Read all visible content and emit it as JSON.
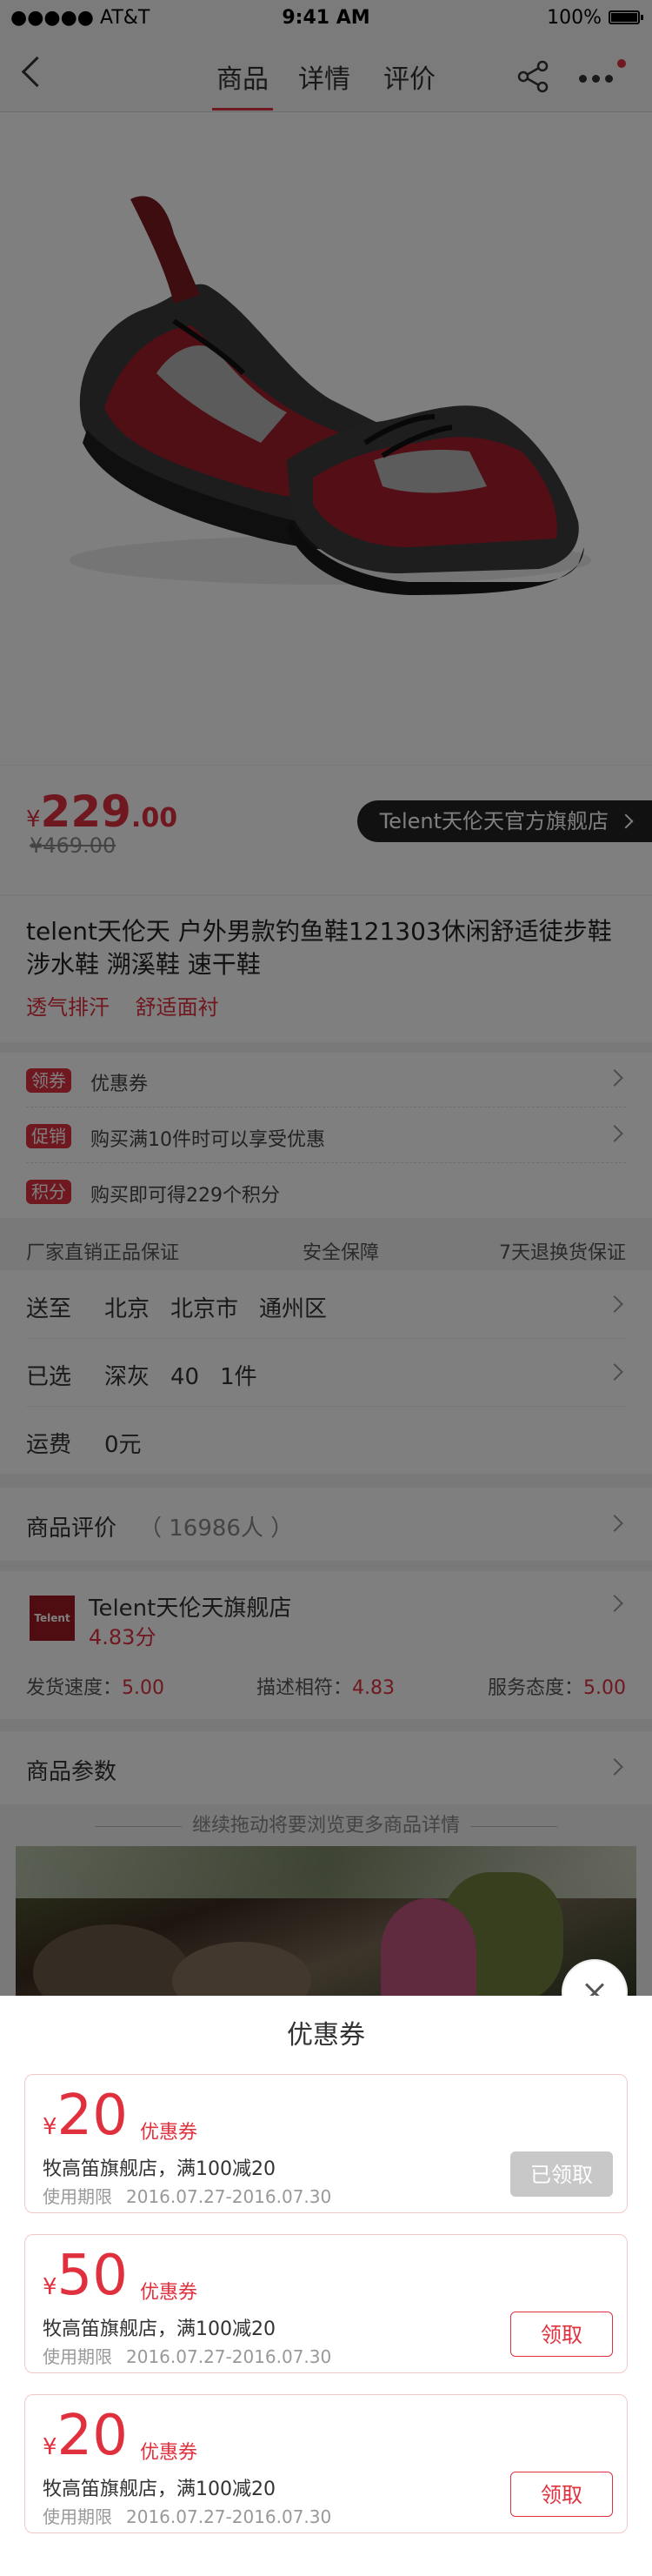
{
  "status": {
    "carrier": "●●●●● AT&T",
    "time": "9:41 AM",
    "battery": "100%"
  },
  "nav": {
    "tabs": [
      "商品",
      "详情",
      "评价"
    ],
    "active_tab": 0
  },
  "carousel": {
    "count": 5,
    "active": 0
  },
  "price": {
    "currency": "¥",
    "int": "229",
    "dec": ".00",
    "old": "¥469.00"
  },
  "store_pill": "Telent天伦天官方旗舰店",
  "product": {
    "title": "telent天伦天 户外男款钓鱼鞋121303休闲舒适徒步鞋涉水鞋 溯溪鞋 速干鞋",
    "tags": [
      "透气排汗",
      "舒适面衬"
    ]
  },
  "promos": [
    {
      "badge": "领券",
      "text": "优惠券"
    },
    {
      "badge": "促销",
      "text": "购买满10件时可以享受优惠"
    },
    {
      "badge": "积分",
      "text": "购买即可得229个积分"
    }
  ],
  "guarantees": [
    "厂家直销正品保证",
    "安全保障",
    "7天退换货保证"
  ],
  "delivery": {
    "ship_label": "送至",
    "ship_values": [
      "北京",
      "北京市",
      "通州区"
    ],
    "sel_label": "已选",
    "sel_values": [
      "深灰",
      "40",
      "1件"
    ],
    "fee_label": "运费",
    "fee_value": "0元"
  },
  "review": {
    "label": "商品评价",
    "count": "（ 16986人 ）"
  },
  "shop": {
    "logo_text": "Telent",
    "name": "Telent天伦天旗舰店",
    "score": "4.83分",
    "metrics": [
      {
        "label": "发货速度：",
        "value": "5.00"
      },
      {
        "label": "描述相符：",
        "value": "4.83"
      },
      {
        "label": "服务态度：",
        "value": "5.00"
      }
    ]
  },
  "params_label": "商品参数",
  "drag_hint": "继续拖动将要浏览更多商品详情",
  "coupon_sheet": {
    "title": "优惠券",
    "coupons": [
      {
        "currency": "¥",
        "amount": "20",
        "type": "优惠券",
        "desc": "牧高笛旗舰店，满100减20",
        "date_label": "使用期限",
        "date": "2016.07.27-2016.07.30",
        "button": "已领取",
        "claimed": true
      },
      {
        "currency": "¥",
        "amount": "50",
        "type": "优惠券",
        "desc": "牧高笛旗舰店，满100减20",
        "date_label": "使用期限",
        "date": "2016.07.27-2016.07.30",
        "button": "领取",
        "claimed": false
      },
      {
        "currency": "¥",
        "amount": "20",
        "type": "优惠券",
        "desc": "牧高笛旗舰店，满100减20",
        "date_label": "使用期限",
        "date": "2016.07.27-2016.07.30",
        "button": "领取",
        "claimed": false
      }
    ]
  },
  "colors": {
    "accent": "#e0303e",
    "claimed": "#c8c8c8",
    "store_pill": "#222222"
  }
}
